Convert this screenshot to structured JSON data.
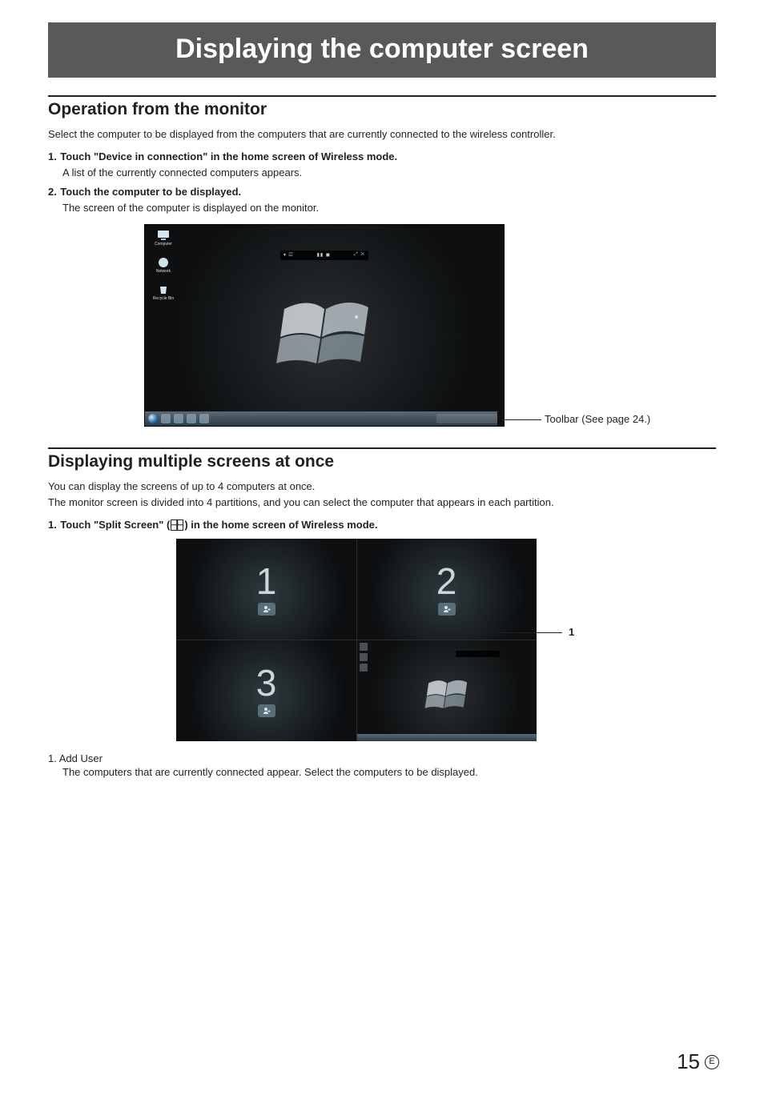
{
  "banner": "Displaying the computer screen",
  "section1": {
    "heading": "Operation from the monitor",
    "intro": "Select the computer to be displayed from the computers that are currently connected to the wireless controller.",
    "steps": [
      {
        "num": "1.",
        "bold": "Touch \"Device in connection\" in the home screen of Wireless mode.",
        "sub": "A list of the currently connected computers appears."
      },
      {
        "num": "2.",
        "bold": "Touch the computer to be displayed.",
        "sub": "The screen of the computer is displayed on the monitor."
      }
    ],
    "callout": "Toolbar (See page 24.)",
    "desktop_icons": {
      "a": "Computer",
      "b": "Network",
      "c": "Recycle Bin"
    }
  },
  "section2": {
    "heading": "Displaying multiple screens at once",
    "intro1": "You can display the screens of up to 4 computers at once.",
    "intro2": "The monitor screen is divided into 4 partitions, and you can select the computer that appears in each partition.",
    "step": {
      "num": "1.",
      "pre": "Touch \"Split Screen\" (",
      "post": ") in the home screen of Wireless mode."
    },
    "quads": {
      "q1": "1",
      "q2": "2",
      "q3": "3"
    },
    "callout_num": "1",
    "legend": {
      "num": "1.",
      "title": "Add User",
      "body": "The computers that are currently connected appear. Select the computers to be displayed."
    }
  },
  "page_number": "15",
  "page_suffix": "E"
}
